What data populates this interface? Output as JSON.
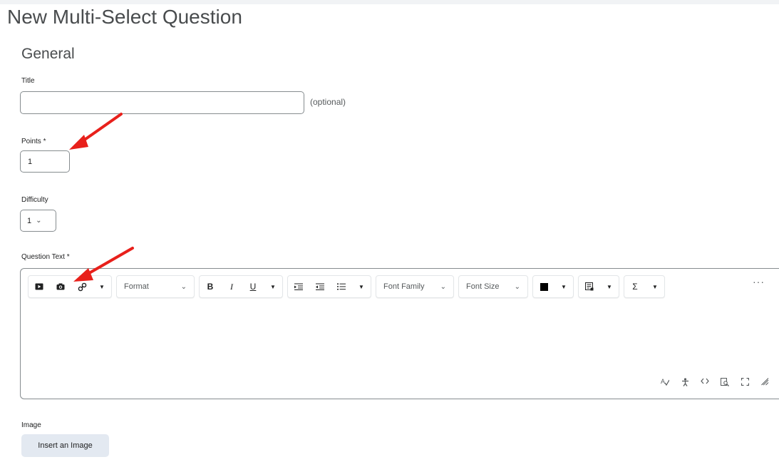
{
  "page": {
    "title": "New Multi-Select Question"
  },
  "general": {
    "heading": "General",
    "title_field": {
      "label": "Title",
      "value": "",
      "placeholder": "",
      "hint": "(optional)"
    },
    "points_field": {
      "label": "Points *",
      "value": "1"
    },
    "difficulty_field": {
      "label": "Difficulty",
      "selected": "1"
    }
  },
  "question_text": {
    "label": "Question Text *",
    "toolbar": {
      "format_label": "Format",
      "bold": "B",
      "italic": "I",
      "underline": "U",
      "font_family_label": "Font Family",
      "font_size_label": "Font Size",
      "equation": "Σ",
      "more": "···"
    },
    "icons": [
      "video-icon",
      "camera-icon",
      "link-icon",
      "indent-icon",
      "outdent-icon",
      "list-icon",
      "color-swatch-icon",
      "insert-stuff-icon",
      "spellcheck-icon",
      "accessibility-icon",
      "source-code-icon",
      "preview-icon",
      "fullscreen-icon",
      "resize-handle-icon"
    ],
    "colors": {
      "text_color_swatch": "#000000"
    }
  },
  "image": {
    "label": "Image",
    "button_label": "Insert an Image"
  },
  "annotations": {
    "arrow_color": "#e8201b"
  }
}
